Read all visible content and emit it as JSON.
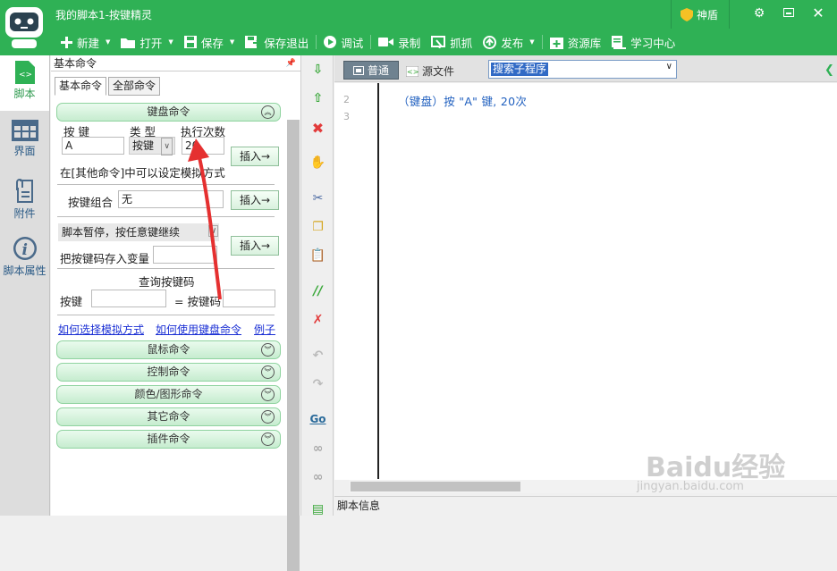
{
  "window": {
    "title": "我的脚本1-按键精灵",
    "shield_label": "神盾",
    "colors": {
      "accent": "#2fb155",
      "link": "#1a2fd4",
      "code": "#1f5fbf"
    }
  },
  "toolbar": {
    "new": "新建",
    "open": "打开",
    "save": "保存",
    "save_exit": "保存退出",
    "debug": "调试",
    "record": "录制",
    "capture": "抓抓",
    "publish": "发布",
    "resources": "资源库",
    "learning": "学习中心"
  },
  "nav": {
    "script": "脚本",
    "ui": "界面",
    "attachments": "附件",
    "properties": "脚本属性"
  },
  "panel": {
    "title": "基本命令",
    "tabs": [
      "基本命令",
      "全部命令"
    ],
    "keyboard": {
      "header": "键盘命令",
      "col_key": "按 键",
      "col_type": "类 型",
      "col_count": "执行次数",
      "key_value": "A",
      "type_value": "按键",
      "count_value": "20",
      "insert": "插入→",
      "note": "在[其他命令]中可以设定模拟方式"
    },
    "combo": {
      "label": "按键组合",
      "value": "无",
      "insert": "插入→"
    },
    "pause": {
      "label": "脚本暂停，按任意键继续",
      "save_var": "把按键码存入变量",
      "insert": "插入→"
    },
    "query": {
      "title": "查询按键码",
      "key_label": "按键",
      "code_label": "= 按键码"
    },
    "links": [
      "如何选择模拟方式",
      "如何使用键盘命令",
      "例子"
    ],
    "sections": [
      "鼠标命令",
      "控制命令",
      "颜色/图形命令",
      "其它命令",
      "插件命令"
    ]
  },
  "editor": {
    "mode_normal": "普通",
    "mode_source": "源文件",
    "sub_select": "搜索子程序",
    "lines": [
      "2",
      "3"
    ],
    "code_line": "（键盘）按 \"A\" 键, 20次",
    "info": "脚本信息"
  },
  "watermark": {
    "brand": "Baidu经验",
    "url": "jingyan.baidu.com"
  }
}
